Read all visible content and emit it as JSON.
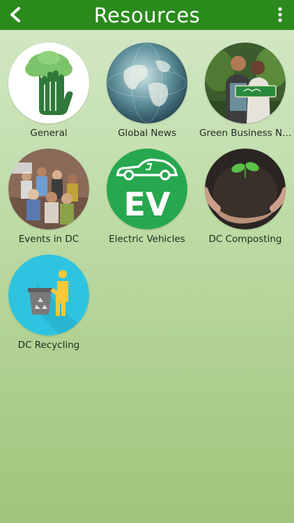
{
  "header": {
    "title": "Resources",
    "bar_color": "#2a8a1c",
    "back_icon": "back-chevron-icon",
    "menu_icon": "more-vertical-icon"
  },
  "tiles": [
    {
      "label": "General",
      "icon": "tree-hand-icon"
    },
    {
      "label": "Global News",
      "icon": "globe-icon"
    },
    {
      "label": "Green Business N...",
      "icon": "shop-owners-photo"
    },
    {
      "label": "Events in DC",
      "icon": "crowd-photo"
    },
    {
      "label": "Electric Vehicles",
      "icon": "ev-car-icon"
    },
    {
      "label": "DC Composting",
      "icon": "soil-sprout-photo"
    },
    {
      "label": "DC Recycling",
      "icon": "recycle-bin-icon"
    }
  ],
  "ev_text": "EV"
}
